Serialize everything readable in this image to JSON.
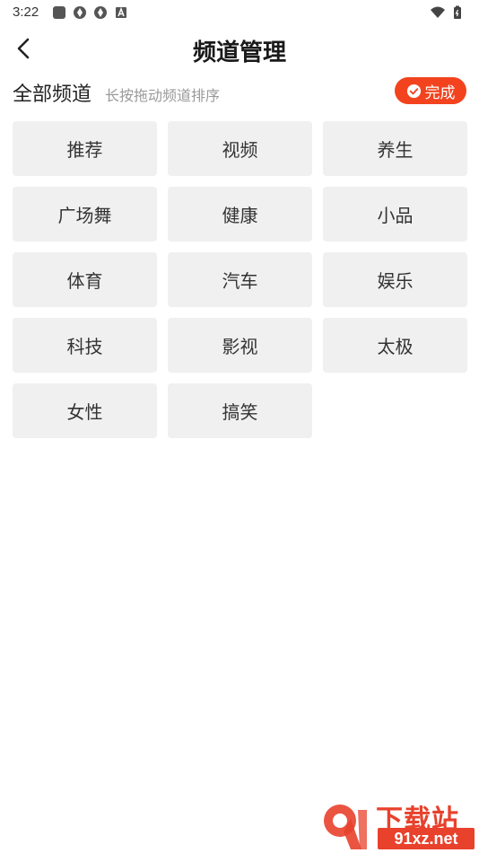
{
  "status_bar": {
    "time": "3:22",
    "left_icons": [
      "square-notification-icon",
      "aperture-icon",
      "aperture-icon",
      "font-a-icon"
    ],
    "right_icons": [
      "wifi-icon",
      "battery-icon"
    ]
  },
  "header": {
    "title": "频道管理",
    "back_icon": "chevron-left-icon"
  },
  "section": {
    "title": "全部频道",
    "hint": "长按拖动频道排序",
    "done_label": "完成",
    "accent_color": "#f2431e"
  },
  "channels": [
    {
      "label": "推荐"
    },
    {
      "label": "视频"
    },
    {
      "label": "养生"
    },
    {
      "label": "广场舞"
    },
    {
      "label": "健康"
    },
    {
      "label": "小品"
    },
    {
      "label": "体育"
    },
    {
      "label": "汽车"
    },
    {
      "label": "娱乐"
    },
    {
      "label": "科技"
    },
    {
      "label": "影视"
    },
    {
      "label": "太极"
    },
    {
      "label": "女性"
    },
    {
      "label": "搞笑"
    }
  ],
  "watermark": {
    "brand_cn": "下载站",
    "url": "91xz.net",
    "color": "#e8412c"
  }
}
